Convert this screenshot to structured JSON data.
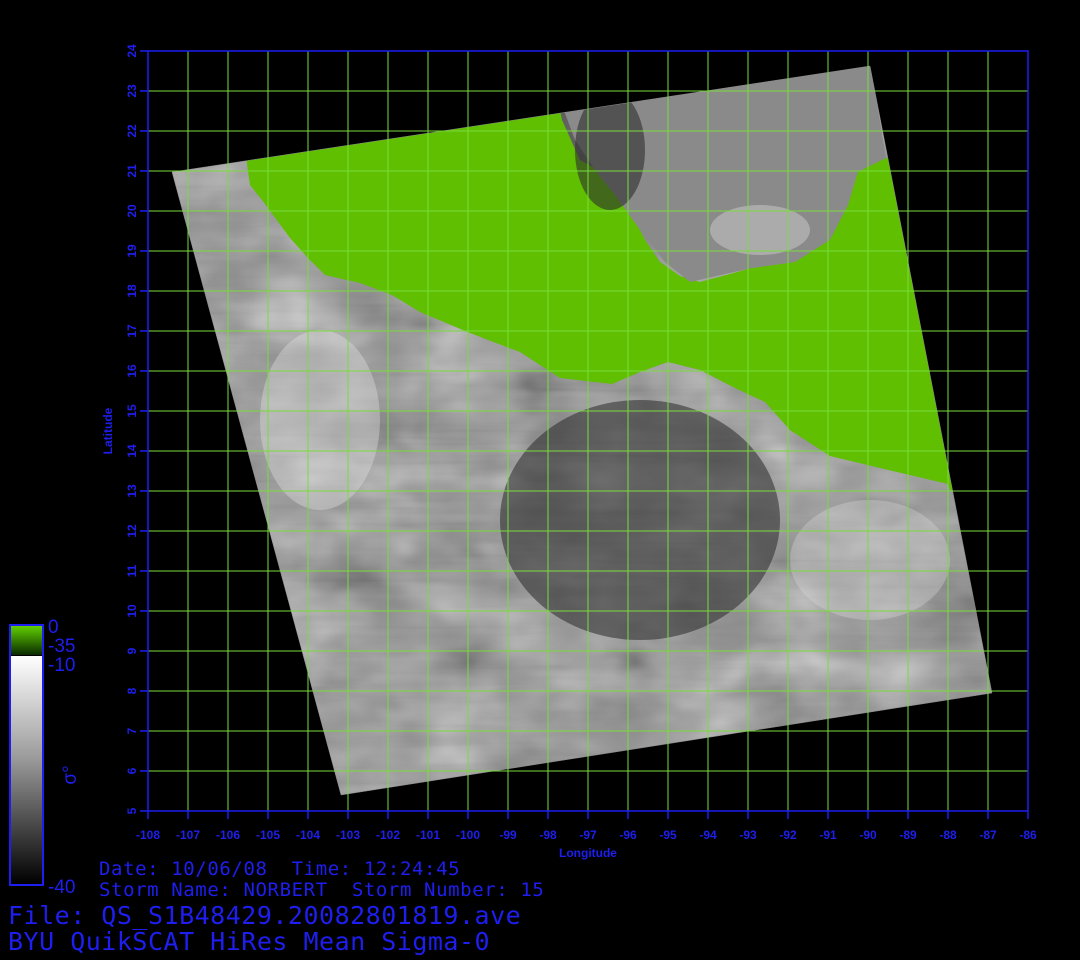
{
  "map": {
    "x_axis_label": "Longitude",
    "y_axis_label": "Latitude",
    "x_ticks": [
      "-108",
      "-107",
      "-106",
      "-105",
      "-104",
      "-103",
      "-102",
      "-101",
      "-100",
      "-99",
      "-98",
      "-97",
      "-96",
      "-95",
      "-94",
      "-93",
      "-92",
      "-91",
      "-90",
      "-89",
      "-88",
      "-87",
      "-86"
    ],
    "y_ticks": [
      "5",
      "6",
      "7",
      "8",
      "9",
      "10",
      "11",
      "12",
      "13",
      "14",
      "15",
      "16",
      "17",
      "18",
      "19",
      "20",
      "21",
      "22",
      "23",
      "24"
    ],
    "lon_range": [
      -108,
      -86
    ],
    "lat_range": [
      5,
      24
    ],
    "frame_color": "#1e1ef0",
    "grid_color": "#78dc3c",
    "land_color": "#5fbf00"
  },
  "legend": {
    "land_max": "0",
    "land_min": "-35",
    "scale_max": "-10",
    "scale_min": "-40",
    "symbol": "σ°"
  },
  "info": {
    "date_line": "Date: 10/06/08  Time: 12:24:45",
    "storm_line": "Storm Name: NORBERT  Storm Number: 15",
    "file_line": "File: QS_S1B48429.20082801819.ave",
    "product_line": "BYU QuikSCAT HiRes Mean Sigma-0"
  }
}
